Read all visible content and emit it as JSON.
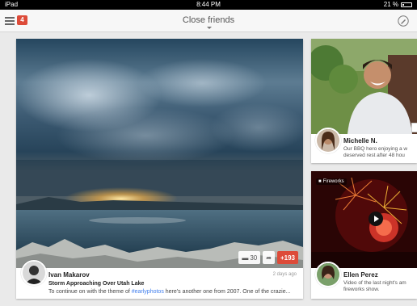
{
  "status_bar": {
    "device": "iPad",
    "time": "8:44 PM",
    "battery": "21 %"
  },
  "app_bar": {
    "title": "Close friends",
    "notification_count": "4"
  },
  "main_post": {
    "author": "Ivan Makarov",
    "time": "2 days ago",
    "title": "Storm Approaching Over Utah Lake",
    "body_prefix": "To continue on with the theme of ",
    "hashtag": "#earlyphotos",
    "body_suffix": " here's another one from 2007. One of the crazie...",
    "comment_count": "30",
    "plus_count": "+193"
  },
  "side_posts": [
    {
      "author": "Michelle N.",
      "text_line1": "Our BBQ hero enjoying a w",
      "text_line2": "deserved rest after 48 hou"
    },
    {
      "author": "Ellen Perez",
      "label": "Fireworks",
      "text_line1": "Video of the last night's am",
      "text_line2": "fireworks show."
    }
  ],
  "colors": {
    "accent_red": "#dd4b39",
    "link_blue": "#427fed"
  }
}
